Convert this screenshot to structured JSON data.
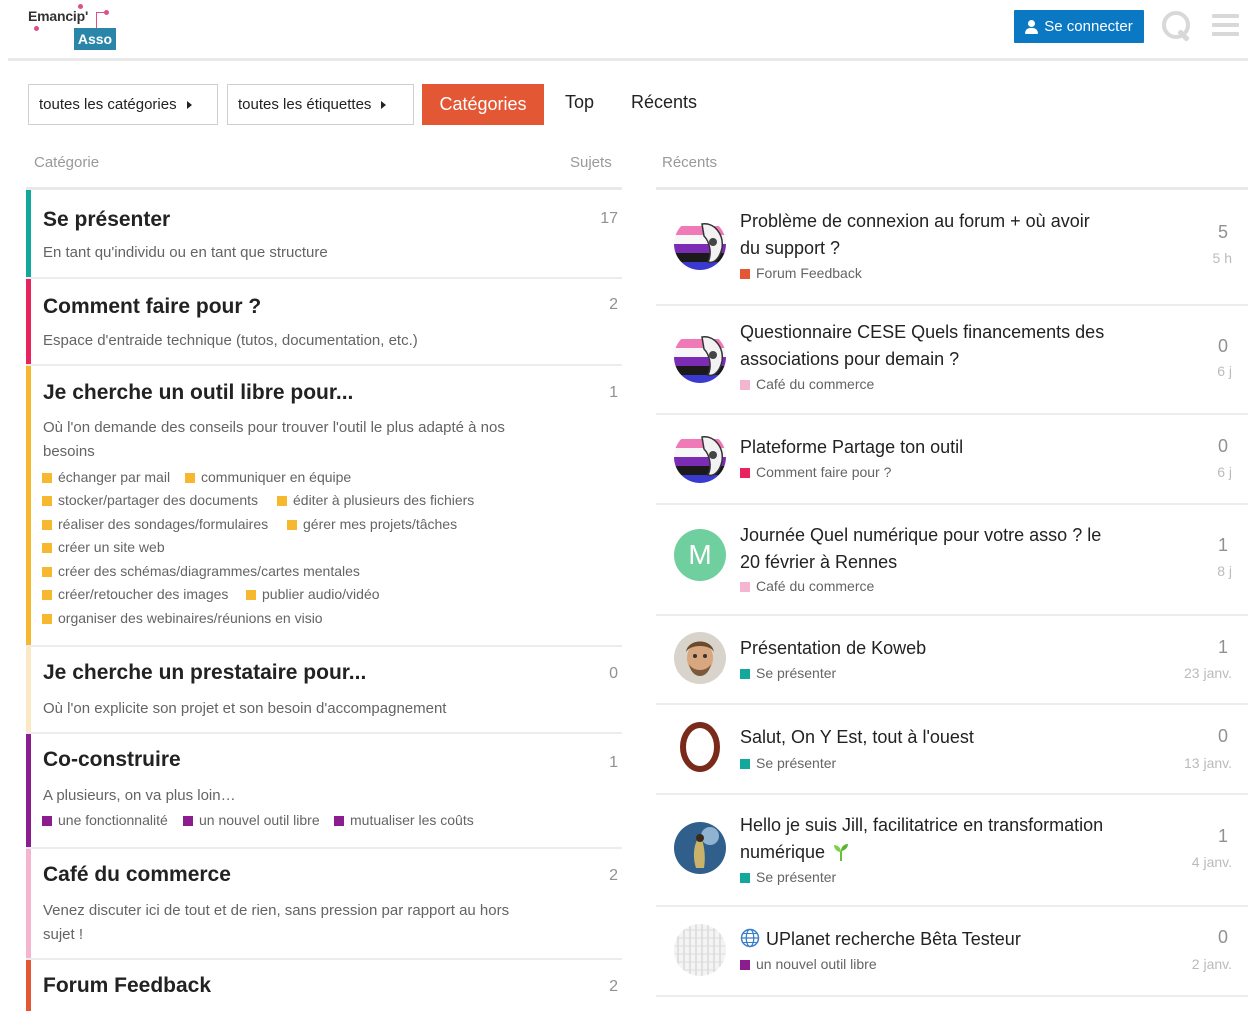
{
  "header": {
    "logo_top": "Emancip'",
    "logo_bottom": "Asso",
    "login_label": "Se connecter"
  },
  "nav": {
    "categories_dropdown": "toutes les catégories",
    "tags_dropdown": "toutes les étiquettes",
    "tabs": [
      "Catégories",
      "Top",
      "Récents"
    ]
  },
  "columns": {
    "category": "Catégorie",
    "topics": "Sujets",
    "recent": "Récents"
  },
  "categories": [
    {
      "title": "Se présenter",
      "desc": "En tant qu'individu ou en tant que structure",
      "count": "17",
      "color": "#12a89d",
      "subs": []
    },
    {
      "title": "Comment faire pour ?",
      "desc": "Espace d'entraide technique (tutos, documentation, etc.)",
      "count": "2",
      "color": "#e8235e",
      "subs": []
    },
    {
      "title": "Je cherche un outil libre pour...",
      "desc": "Où l'on demande des conseils pour trouver l'outil le plus adapté à nos besoins",
      "count": "1",
      "color": "#f5b82e",
      "subs": [
        "échanger par mail",
        "communiquer en équipe",
        "stocker/partager des documents",
        "éditer à plusieurs des fichiers",
        "réaliser des sondages/formulaires",
        "gérer mes projets/tâches",
        "créer un site web",
        "créer des schémas/diagrammes/cartes mentales",
        "créer/retoucher des images",
        "publier audio/vidéo",
        "organiser des webinaires/réunions en visio"
      ]
    },
    {
      "title": "Je cherche un prestataire pour...",
      "desc": "Où l'on explicite son projet et son besoin d'accompagnement",
      "count": "0",
      "color": "#fbe8c4",
      "subs": []
    },
    {
      "title": "Co-construire",
      "desc": "A plusieurs, on va plus loin…",
      "count": "1",
      "color": "#8c1d8e",
      "subs": [
        "une fonctionnalité",
        "un nouvel outil libre",
        "mutualiser les coûts"
      ]
    },
    {
      "title": "Café du commerce",
      "desc": "Venez discuter ici de tout et de rien, sans pression par rapport au hors sujet !",
      "count": "2",
      "color": "#f5b5d0",
      "subs": []
    },
    {
      "title": "Forum Feedback",
      "desc": "",
      "count": "2",
      "color": "#e45735",
      "subs": []
    }
  ],
  "topics": [
    {
      "title": "Problème de connexion au forum + où avoir du support ?",
      "category": "Forum Feedback",
      "cat_color": "#e45735",
      "replies": "5",
      "age": "5 h",
      "avatar": "flag"
    },
    {
      "title": "Questionnaire CESE Quels financements des associations pour demain ?",
      "category": "Café du commerce",
      "cat_color": "#f5b5d0",
      "replies": "0",
      "age": "6 j",
      "avatar": "flag"
    },
    {
      "title": "Plateforme Partage ton outil",
      "category": "Comment faire pour ?",
      "cat_color": "#e8235e",
      "replies": "0",
      "age": "6 j",
      "avatar": "flag"
    },
    {
      "title": "Journée Quel numérique pour votre asso ? le 20 février à Rennes",
      "category": "Café du commerce",
      "cat_color": "#f5b5d0",
      "replies": "1",
      "age": "8 j",
      "avatar": "M"
    },
    {
      "title": "Présentation de Koweb",
      "category": "Se présenter",
      "cat_color": "#12a89d",
      "replies": "1",
      "age": "23 janv.",
      "avatar": "face"
    },
    {
      "title": "Salut, On Y Est, tout à l'ouest",
      "category": "Se présenter",
      "cat_color": "#12a89d",
      "replies": "0",
      "age": "13 janv.",
      "avatar": "ring"
    },
    {
      "title": "Hello je suis Jill, facilitatrice en transformation numérique",
      "category": "Se présenter",
      "cat_color": "#12a89d",
      "replies": "1",
      "age": "4 janv.",
      "avatar": "bird"
    },
    {
      "title": "UPlanet recherche Bêta Testeur",
      "category": "un nouvel outil libre",
      "cat_color": "#8c1d8e",
      "replies": "0",
      "age": "2 janv.",
      "avatar": "grid"
    }
  ]
}
